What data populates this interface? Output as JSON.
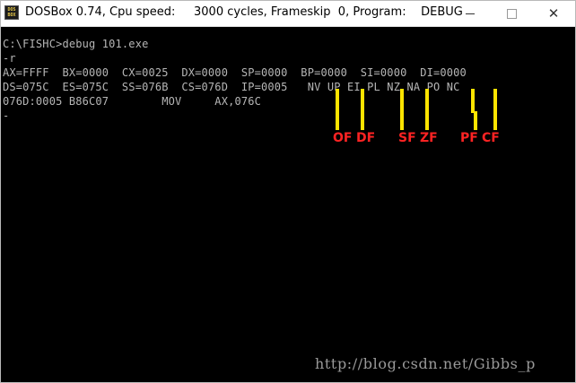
{
  "window": {
    "title": "DOSBox 0.74, Cpu speed:     3000 cycles, Frameskip  0, Program:    DEBUG",
    "icon_label": "DOS BOX",
    "minimize_icon": "minimize-icon",
    "maximize_icon": "maximize-icon",
    "close_glyph": "✕"
  },
  "console": {
    "lines": [
      "C:\\FISHC>debug 101.exe",
      "-r",
      "AX=FFFF  BX=0000  CX=0025  DX=0000  SP=0000  BP=0000  SI=0000  DI=0000",
      "DS=075C  ES=075C  SS=076B  CS=076D  IP=0005   NV UP EI PL NZ NA PO NC",
      "076D:0005 B86C07        MOV     AX,076C",
      "-"
    ]
  },
  "annotations": {
    "color_bar": "#ffe400",
    "color_label": "#ff2323",
    "labels": [
      "OF",
      "DF",
      "SF",
      "ZF",
      "PF",
      "CF"
    ]
  },
  "watermark": "http://blog.csdn.net/Gibbs_p"
}
